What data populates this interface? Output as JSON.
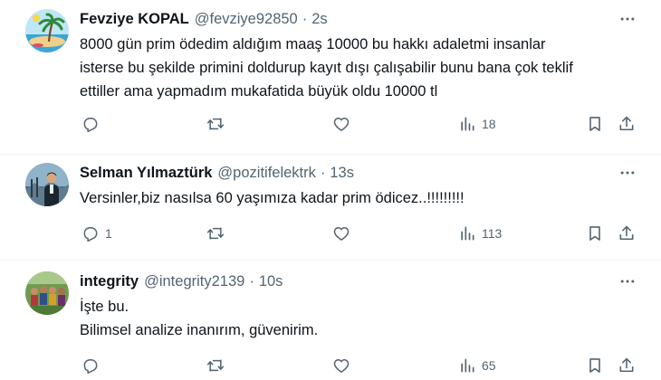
{
  "tweets": [
    {
      "name": "Fevziye KOPAL",
      "handle": "@fevziye92850",
      "separator": "·",
      "time": "2s",
      "text_lines": [
        "8000 gün prim ödedim aldığım maaş 10000 bu hakkı adaletmi insanlar",
        "isterse bu şekilde primini doldurup kayıt dışı çalışabilir bunu bana çok teklif",
        "ettiller ama yapmadım mukafatida büyük oldu 10000 tl"
      ],
      "reply_count": "",
      "view_count": "18",
      "avatar_icon": "beach-palm-avatar"
    },
    {
      "name": "Selman Yılmaztürk",
      "handle": "@pozitifelektrk",
      "separator": "·",
      "time": "13s",
      "text_lines": [
        "Versinler,biz nasılsa 60 yaşımıza kadar prim ödicez..!!!!!!!!!"
      ],
      "reply_count": "1",
      "view_count": "113",
      "avatar_icon": "person-photo-avatar"
    },
    {
      "name": "integrity",
      "handle": "@integrity2139",
      "separator": "·",
      "time": "10s",
      "text_lines": [
        "İşte bu.",
        "Bilimsel analize inanırım, güvenirim."
      ],
      "reply_count": "",
      "view_count": "65",
      "avatar_icon": "group-photo-avatar"
    }
  ],
  "icons": {
    "more": "more-dots-icon",
    "reply": "reply-icon",
    "retweet": "retweet-icon",
    "like": "heart-icon",
    "views": "views-icon",
    "bookmark": "bookmark-icon",
    "share": "share-icon"
  },
  "colors": {
    "text": "#0f1419",
    "secondary": "#536471",
    "divider": "#eff3f4"
  }
}
